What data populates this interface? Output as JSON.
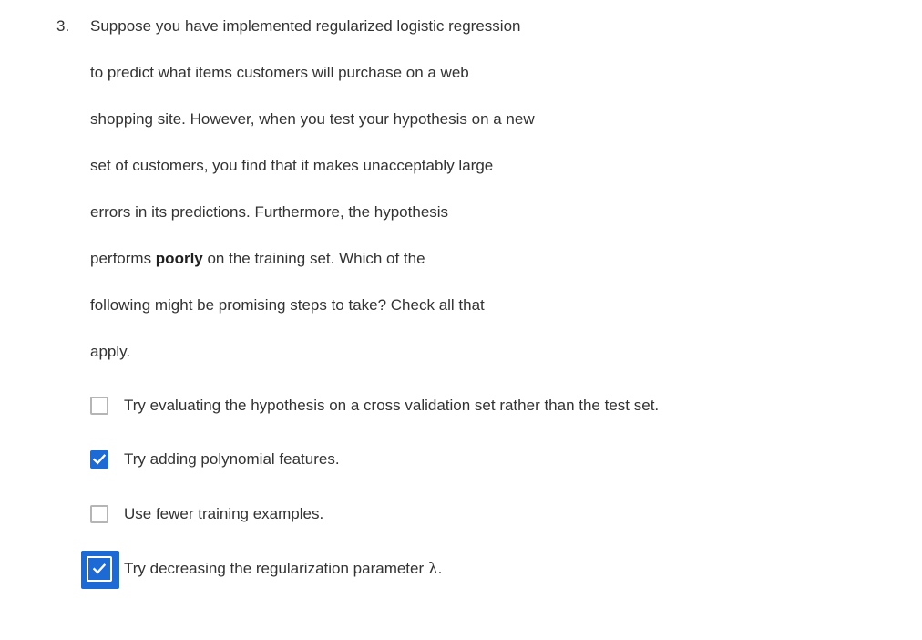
{
  "question": {
    "number": "3.",
    "lines": [
      "Suppose you have implemented regularized logistic regression",
      "to predict what items customers will purchase on a web",
      "shopping site. However, when you test your hypothesis on a new",
      "set of customers, you find that it makes unacceptably large",
      "errors in its predictions. Furthermore, the hypothesis",
      "",
      "following might be promising steps to take? Check all that",
      "apply."
    ],
    "line6": {
      "before": "performs ",
      "bold": "poorly",
      "after": " on the training set. Which of the"
    }
  },
  "options": [
    {
      "label": "Try evaluating the hypothesis on a cross validation set rather than the test set.",
      "checked": false
    },
    {
      "label": "Try adding polynomial features.",
      "checked": true
    },
    {
      "label": "Use fewer training examples.",
      "checked": false
    },
    {
      "label": "Try decreasing the regularization parameter ",
      "symbol": "λ",
      "suffix": ".",
      "checked": true,
      "focused": true
    }
  ],
  "colors": {
    "accent": "#1d6ad4",
    "text": "#333333",
    "unchecked_border": "#b5b5b5"
  },
  "icons": {
    "checkmark": "checkmark-icon"
  }
}
